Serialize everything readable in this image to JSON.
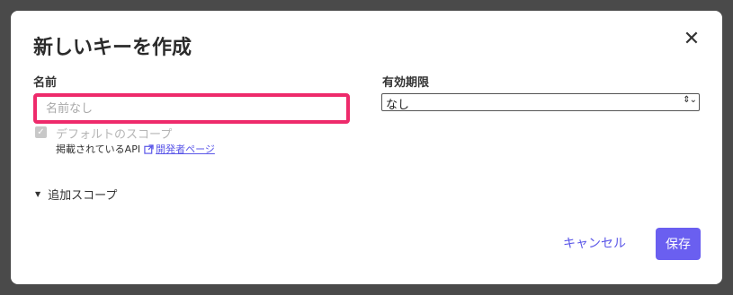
{
  "dialog": {
    "title": "新しいキーを作成",
    "close_icon": "close-icon"
  },
  "form": {
    "name_label": "名前",
    "name_placeholder": "名前なし",
    "name_value": "",
    "highlight_color": "#ee2a6b",
    "expiry_label": "有効期限",
    "expiry_value": "なし",
    "default_scope_label": "デフォルトのスコープ",
    "default_scope_checked": true,
    "api_text": "掲載されているAPI",
    "dev_page_link": "開発者ページ",
    "additional_scope_label": "追加スコープ"
  },
  "footer": {
    "cancel_label": "キャンセル",
    "save_label": "保存"
  },
  "colors": {
    "accent": "#6a5ff0",
    "link": "#5b57e8"
  }
}
